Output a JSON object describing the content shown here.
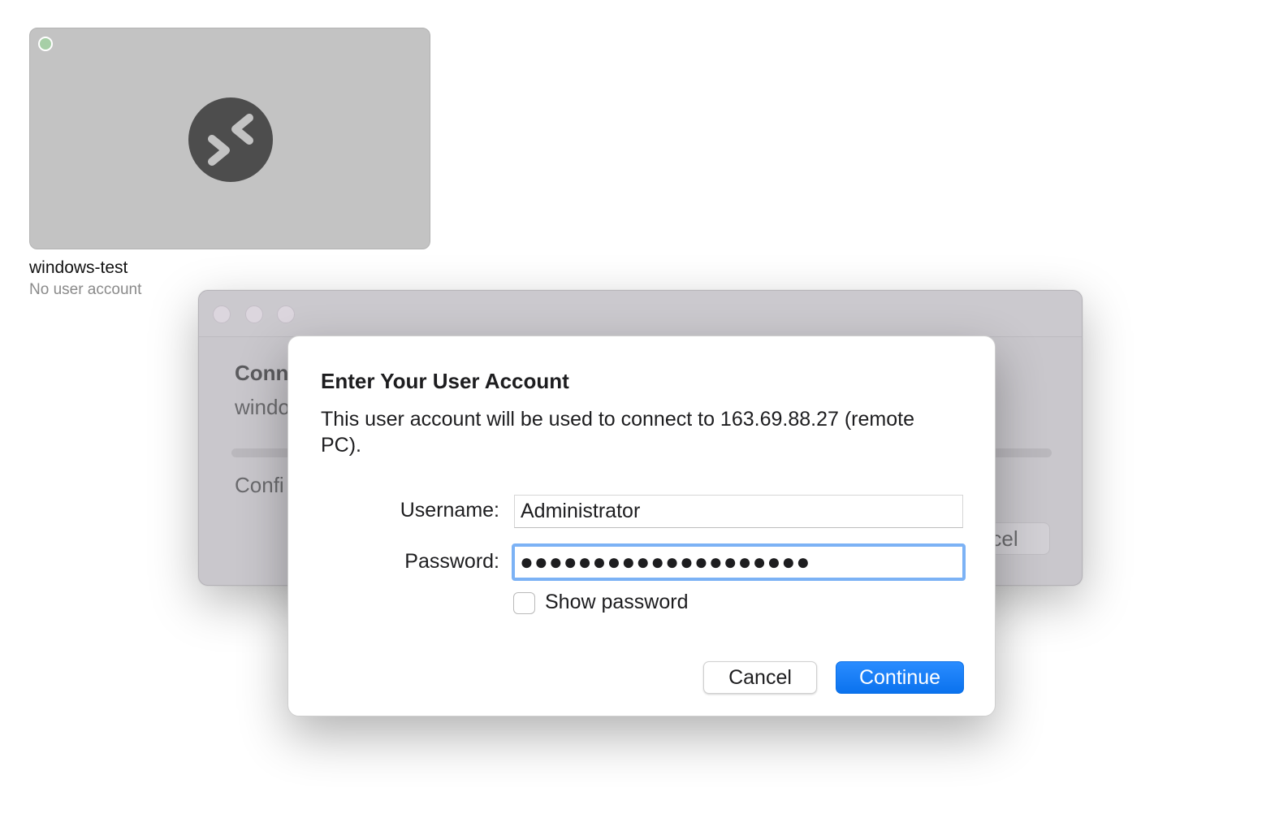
{
  "pc_tile": {
    "name": "windows-test",
    "user": "No user account",
    "status_color": "#a7cfa7",
    "icon": "remote-desktop-icon"
  },
  "bg_window": {
    "heading": "Conn",
    "subtitle": "windo",
    "status": "Confi",
    "cancel_label": "cel"
  },
  "dialog": {
    "title": "Enter Your User Account",
    "message": "This user account will be used to connect to 163.69.88.27 (remote PC).",
    "username_label": "Username:",
    "username_value": "Administrator",
    "password_label": "Password:",
    "password_mask": "●●●●●●●●●●●●●●●●●●●●",
    "show_password_label": "Show password",
    "show_password_checked": false,
    "cancel_label": "Cancel",
    "continue_label": "Continue",
    "accent_color": "#0a72ee",
    "focus_ring_color": "#7cb2f5"
  }
}
